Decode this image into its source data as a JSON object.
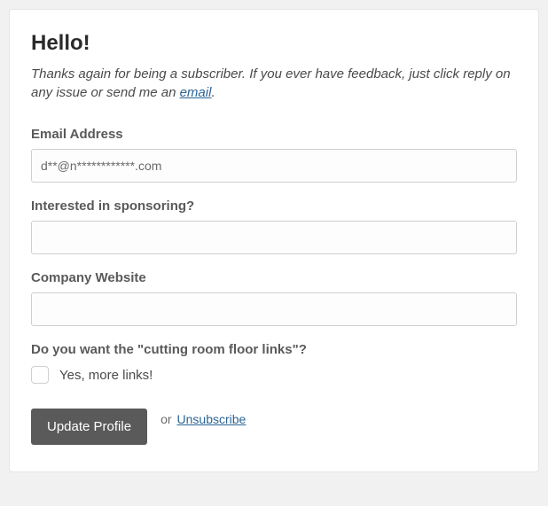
{
  "header": {
    "title": "Hello!",
    "intro_before_link": "Thanks again for being a subscriber. If you ever have feedback, just click reply on any issue or send me an ",
    "email_link_text": "email",
    "intro_after_link": "."
  },
  "form": {
    "email": {
      "label": "Email Address",
      "value": "d**@n************.com"
    },
    "sponsor": {
      "label": "Interested in sponsoring?",
      "value": ""
    },
    "website": {
      "label": "Company Website",
      "value": ""
    },
    "cutting": {
      "label": "Do you want the \"cutting room floor links\"?",
      "checkbox_label": "Yes, more links!"
    }
  },
  "actions": {
    "update_label": "Update Profile",
    "or": "or",
    "unsubscribe": "Unsubscribe"
  }
}
